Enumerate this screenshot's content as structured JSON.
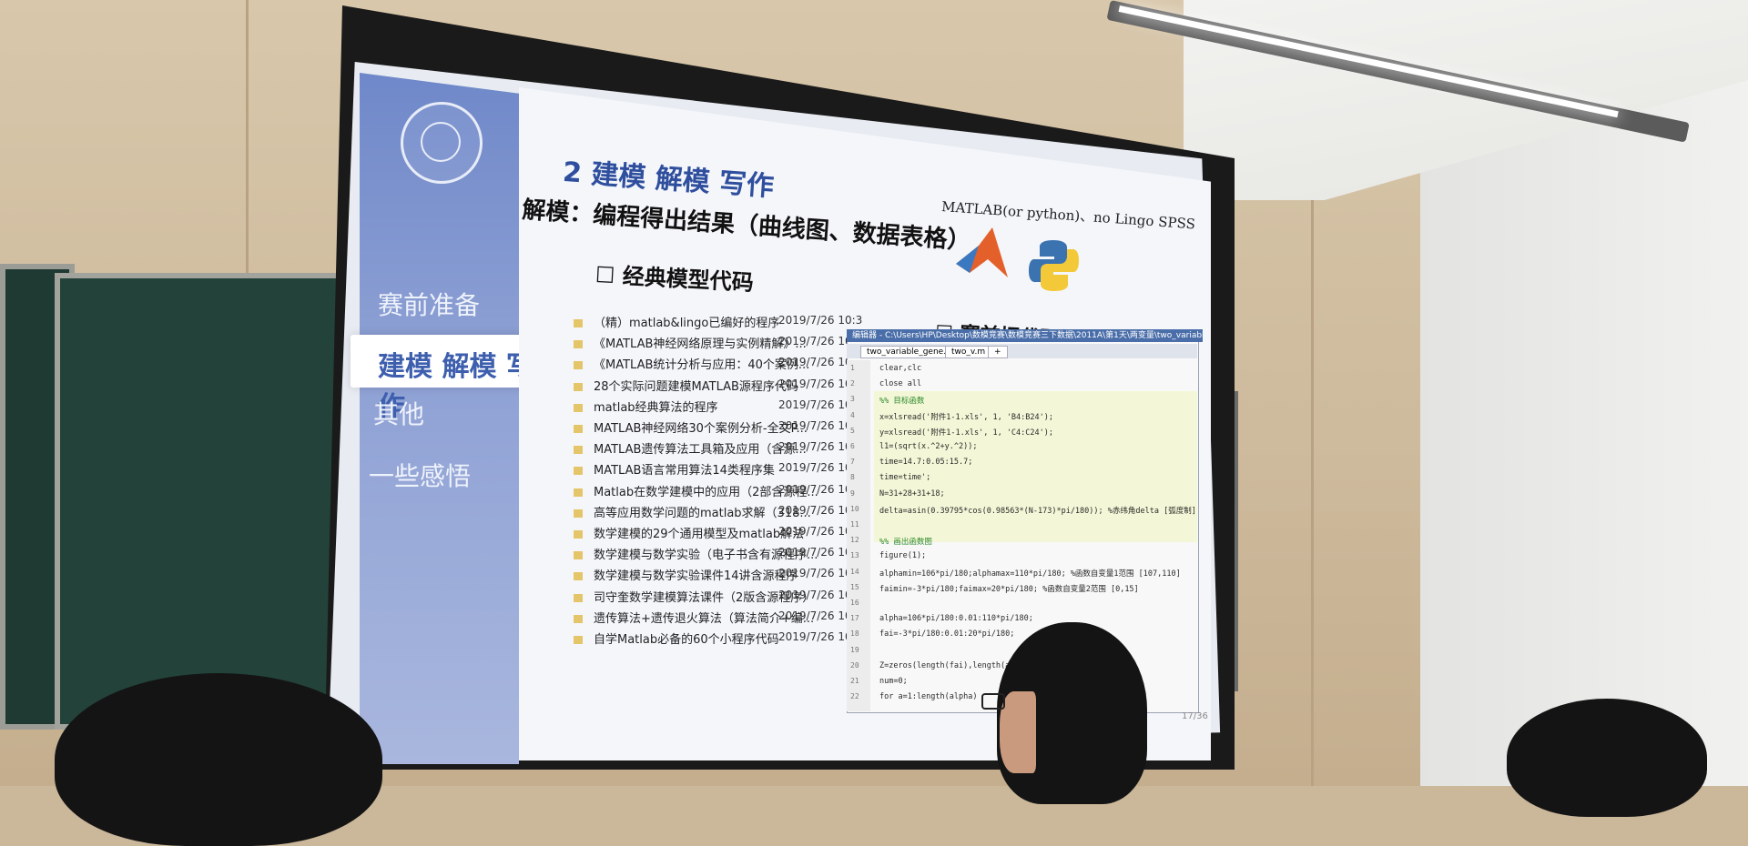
{
  "slide": {
    "title": "2 建模 解模 写作",
    "subtitle": "解模：编程得出结果（曲线图、数据表格）",
    "tools_note": "MATLAB(or python)、no Lingo SPSS",
    "section_models": "☐ 经典模型代码",
    "section_debug": "☐ 赛前把代码调试好",
    "page_number": "17/36"
  },
  "sidebar": {
    "items": [
      {
        "label": "赛前准备"
      },
      {
        "label": "建模 解模 写作"
      },
      {
        "label": "其他"
      },
      {
        "label": "一些感悟"
      }
    ]
  },
  "file_list": [
    {
      "name": "（精）matlab&lingo已编好的程序",
      "date": "2019/7/26 10:3"
    },
    {
      "name": "《MATLAB神经网络原理与实例精解》...",
      "date": "2019/7/26 10:3"
    },
    {
      "name": "《MATLAB统计分析与应用：40个案例...",
      "date": "2019/7/26 10:3"
    },
    {
      "name": "28个实际问题建模MATLAB源程序代码",
      "date": "2019/7/26 10:3"
    },
    {
      "name": "matlab经典算法的程序",
      "date": "2019/7/26 10:3"
    },
    {
      "name": "MATLAB神经网络30个案例分析-全文P...",
      "date": "2019/7/26 10:4"
    },
    {
      "name": "MATLAB遗传算法工具箱及应用（含源...",
      "date": "2019/7/26 10:4"
    },
    {
      "name": "MATLAB语言常用算法14类程序集",
      "date": "2019/7/26 10:3"
    },
    {
      "name": "Matlab在数学建模中的应用（2部含源程...",
      "date": "2019/7/26 10:3"
    },
    {
      "name": "高等应用数学问题的matlab求解（318...",
      "date": "2019/7/26 10:3"
    },
    {
      "name": "数学建模的29个通用模型及matlab解法",
      "date": "2019/7/26 10:3"
    },
    {
      "name": "数学建模与数学实验（电子书含有源程序...",
      "date": "2019/7/26 10:3"
    },
    {
      "name": "数学建模与数学实验课件14讲含源程序",
      "date": "2019/7/26 10:3"
    },
    {
      "name": "司守奎数学建模算法课件（2版含源程序）",
      "date": "2019/7/26 10:3"
    },
    {
      "name": "遗传算法+遗传退火算法（算法简介+编...",
      "date": "2019/7/26 10:3"
    },
    {
      "name": "自学Matlab必备的60个小程序代码",
      "date": "2019/7/26 10:3"
    }
  ],
  "editor": {
    "title": "编辑器 - C:\\Users\\HP\\Desktop\\数模竞赛\\数模竞赛三下数据\\2011A\\第1天\\两变量\\two_variable_gene.m",
    "tabs": [
      "two_variable_gene.m",
      "two_v.m",
      "+"
    ],
    "lines": [
      {
        "no": "1",
        "code": "clear,clc"
      },
      {
        "no": "2",
        "code": "close all"
      },
      {
        "no": "3",
        "code": "%% 目标函数"
      },
      {
        "no": "4",
        "code": "x=xlsread('附件1-1.xls', 1, 'B4:B24');"
      },
      {
        "no": "5",
        "code": "y=xlsread('附件1-1.xls', 1, 'C4:C24');"
      },
      {
        "no": "6",
        "code": "l1=(sqrt(x.^2+y.^2));"
      },
      {
        "no": "7",
        "code": "time=14.7:0.05:15.7;"
      },
      {
        "no": "8",
        "code": "time=time';"
      },
      {
        "no": "9",
        "code": "N=31+28+31+18;"
      },
      {
        "no": "10",
        "code": "delta=asin(0.39795*cos(0.98563*(N-173)*pi/180)); %赤纬角delta [弧度制]"
      },
      {
        "no": "11",
        "code": ""
      },
      {
        "no": "12",
        "code": "%% 画出函数图"
      },
      {
        "no": "13",
        "code": "figure(1);"
      },
      {
        "no": "14",
        "code": "alphamin=106*pi/180;alphamax=110*pi/180; %函数自变量1范围 [107,110]"
      },
      {
        "no": "15",
        "code": "faimin=-3*pi/180;faimax=20*pi/180; %函数自变量2范围 [0,15]"
      },
      {
        "no": "16",
        "code": ""
      },
      {
        "no": "17",
        "code": "alpha=106*pi/180:0.01:110*pi/180;"
      },
      {
        "no": "18",
        "code": "fai=-3*pi/180:0.01:20*pi/180;"
      },
      {
        "no": "19",
        "code": ""
      },
      {
        "no": "20",
        "code": "Z=zeros(length(fai),length(alpha));"
      },
      {
        "no": "21",
        "code": "num=0;"
      },
      {
        "no": "22",
        "code": "for a=1:length(alpha)"
      }
    ]
  }
}
